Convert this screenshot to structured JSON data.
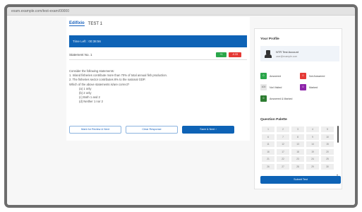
{
  "browser": {
    "url": "exam.example.com/test-exam/00000"
  },
  "header": {
    "logo": "Edifixio",
    "test_title": "TEST 1"
  },
  "timer": {
    "label": "Time Left : 00:38:56"
  },
  "question": {
    "number_label": "Statement No. 1",
    "tag_green": "+1",
    "tag_red": "-0.33",
    "intro": "Consider the following statements:",
    "statements": [
      "1. Inland fisheries contribute more than 70% of total annual fish production.",
      "2. The fisheries sector contributes 8% to the national GDP."
    ],
    "prompt": "Which of the above statements is/are correct?",
    "options": [
      "(a) 1 only",
      "(b) 2 only",
      "(c) Both 1 and 2",
      "(d) Neither 1 nor 2"
    ]
  },
  "actions": {
    "mark_review": "Mark for Review & Next",
    "clear": "Clear Response",
    "save_next": "Save & Next  ›"
  },
  "sidebar": {
    "profile_title": "Your Profile",
    "profile_name": "NTR Test Account",
    "profile_email": "user@example.com",
    "legend": {
      "answered_count": "0",
      "answered_label": "Answered",
      "not_answered_count": "0",
      "not_answered_label": "Not Answered",
      "not_visited_count": "100",
      "not_visited_label": "Not Visited",
      "marked_count": "0",
      "marked_label": "Marked",
      "answered_marked_count": "0",
      "answered_marked_label": "Answered & Marked"
    },
    "palette_title": "Question Palette",
    "palette": [
      "1",
      "2",
      "3",
      "4",
      "5",
      "6",
      "7",
      "8",
      "9",
      "10",
      "11",
      "12",
      "13",
      "14",
      "15",
      "16",
      "17",
      "18",
      "19",
      "20",
      "21",
      "22",
      "23",
      "24",
      "25",
      "26",
      "27",
      "28",
      "29",
      "30"
    ],
    "submit": "Submit Test"
  },
  "colors": {
    "primary": "#0e63b6",
    "answered": "#2aa64a",
    "not_answered": "#e53935",
    "marked": "#8e24aa",
    "answered_marked": "#2e7d32"
  }
}
